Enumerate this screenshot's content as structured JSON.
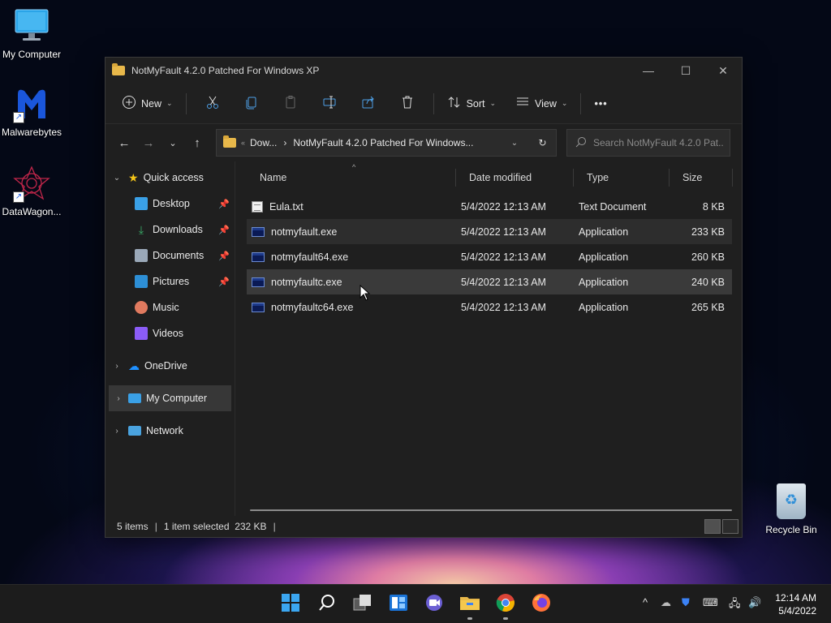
{
  "desktop": {
    "icons": [
      {
        "label": "My Computer"
      },
      {
        "label": "Malwarebytes"
      },
      {
        "label": "DataWagon..."
      }
    ],
    "recycle_bin": "Recycle Bin"
  },
  "window": {
    "title": "NotMyFault 4.2.0 Patched For Windows XP",
    "controls": {
      "minimize": "—",
      "maximize": "☐",
      "close": "✕"
    }
  },
  "commandbar": {
    "new_label": "New",
    "sort_label": "Sort",
    "view_label": "View",
    "more_label": "•••"
  },
  "address": {
    "crumb_parent": "Dow...",
    "crumb_current": "NotMyFault 4.2.0 Patched For Windows...",
    "search_placeholder": "Search NotMyFault 4.2.0 Pat..."
  },
  "navpane": {
    "quick_access": "Quick access",
    "quick_items": [
      {
        "label": "Desktop",
        "color": "#3aa0e6",
        "pinned": true
      },
      {
        "label": "Downloads",
        "color": "#3ab06a",
        "pinned": true
      },
      {
        "label": "Documents",
        "color": "#9aa8b8",
        "pinned": true
      },
      {
        "label": "Pictures",
        "color": "#2d8fd6",
        "pinned": true
      },
      {
        "label": "Music",
        "color": "#e07a5f",
        "pinned": false
      },
      {
        "label": "Videos",
        "color": "#8b5cf6",
        "pinned": false
      }
    ],
    "onedrive": "OneDrive",
    "my_computer": "My Computer",
    "network": "Network"
  },
  "columns": {
    "name": "Name",
    "date": "Date modified",
    "type": "Type",
    "size": "Size"
  },
  "files": [
    {
      "name": "Eula.txt",
      "date": "5/4/2022 12:13 AM",
      "type": "Text Document",
      "size": "8 KB",
      "icon": "text-file-icon"
    },
    {
      "name": "notmyfault.exe",
      "date": "5/4/2022 12:13 AM",
      "type": "Application",
      "size": "233 KB",
      "icon": "application-icon"
    },
    {
      "name": "notmyfault64.exe",
      "date": "5/4/2022 12:13 AM",
      "type": "Application",
      "size": "260 KB",
      "icon": "application-icon"
    },
    {
      "name": "notmyfaultc.exe",
      "date": "5/4/2022 12:13 AM",
      "type": "Application",
      "size": "240 KB",
      "icon": "application-icon"
    },
    {
      "name": "notmyfaultc64.exe",
      "date": "5/4/2022 12:13 AM",
      "type": "Application",
      "size": "265 KB",
      "icon": "application-icon"
    }
  ],
  "status": {
    "items": "5 items",
    "selected": "1 item selected  232 KB"
  },
  "taskbar": {
    "time": "12:14 AM",
    "date": "5/4/2022"
  }
}
